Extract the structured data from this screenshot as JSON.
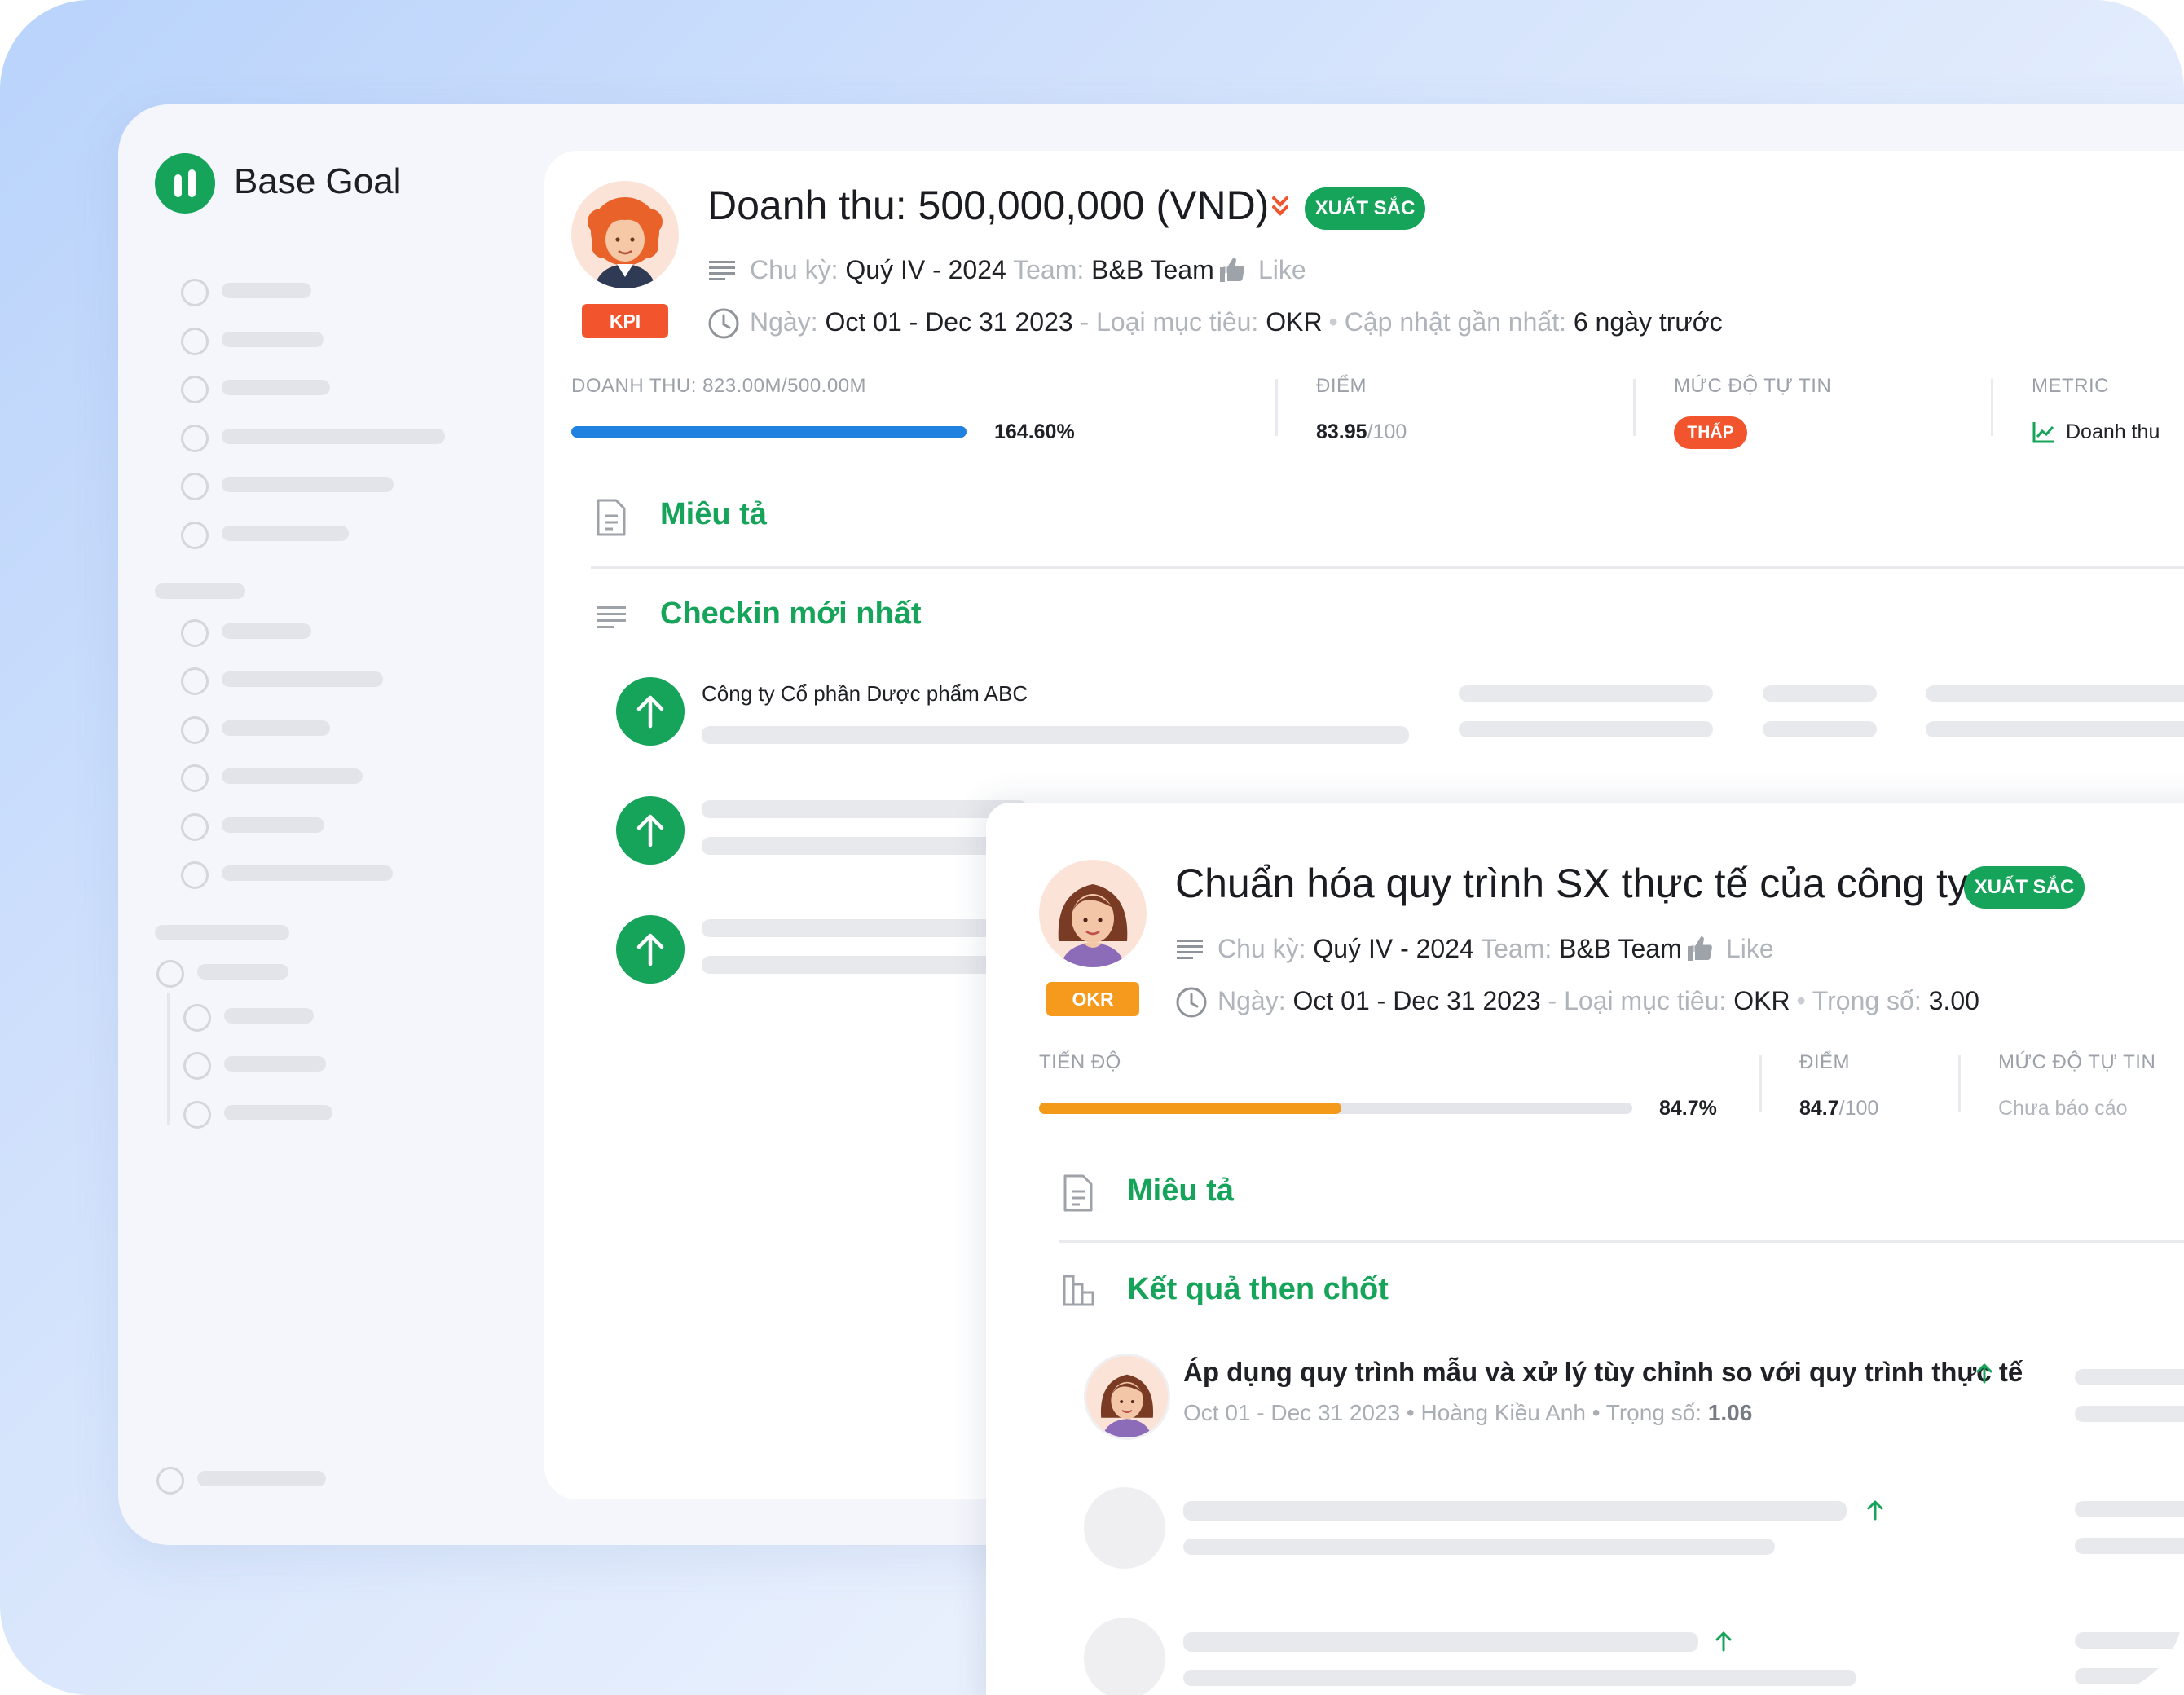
{
  "app": {
    "brand": "Base Goal"
  },
  "goal": {
    "tag": "KPI",
    "title": "Doanh thu: 500,000,000 (VND)",
    "rating": "XUẤT SẮC",
    "cycle_label": "Chu kỳ:",
    "cycle_value": "Quý IV - 2024",
    "team_label": "Team:",
    "team_value": "B&B Team",
    "like": "Like",
    "date_label": "Ngày:",
    "date_value": "Oct 01 - Dec 31 2023",
    "type_label": "- Loại mục tiêu:",
    "type_value": "OKR",
    "updated_label": "Cập nhật gần nhất:",
    "updated_value": "6 ngày trước",
    "progress_label": "DOANH THU: 823.00M/500.00M",
    "progress_value": "164.60%",
    "progress_fraction": 1.0,
    "score_label": "ĐIỂM",
    "score_value": "83.95",
    "score_max": "/100",
    "confidence_label": "MỨC ĐỘ TỰ TIN",
    "confidence_value": "THẤP",
    "metric_label": "METRIC",
    "metric_value": "Doanh thu",
    "description_title": "Miêu tả",
    "checkin_title": "Checkin mới nhất",
    "checkin_company": "Công ty Cổ phần Dược phẩm ABC"
  },
  "okr": {
    "tag": "OKR",
    "title": "Chuẩn hóa quy trình SX thực tế của công ty",
    "rating": "XUẤT SẮC",
    "cycle_label": "Chu kỳ:",
    "cycle_value": "Quý IV - 2024",
    "team_label": "Team:",
    "team_value": "B&B Team",
    "like": "Like",
    "date_label": "Ngày:",
    "date_value": "Oct 01 - Dec 31 2023",
    "type_label": "- Loại mục tiêu:",
    "type_value": "OKR",
    "weight_label": "Trọng số:",
    "weight_value": "3.00",
    "progress_label": "TIẾN ĐỘ",
    "progress_value": "84.7%",
    "progress_fraction": 0.51,
    "score_label": "ĐIỂM",
    "score_value": "84.7",
    "score_max": "/100",
    "confidence_label": "MỨC ĐỘ TỰ TIN",
    "confidence_value": "Chưa báo cáo",
    "description_title": "Miêu tả",
    "kr_section_title": "Kết quả then chốt",
    "key_result": {
      "title": "Áp dụng quy trình mẫu và xử lý tùy chỉnh so với quy trình thực tế",
      "date": "Oct 01 - Dec 31 2023",
      "owner": "Hoàng Kiều Anh",
      "weight_label": "Trọng số:",
      "weight_value": "1.06"
    }
  },
  "colors": {
    "brand_green": "#16a35a",
    "kpi_tag": "#f2542d",
    "okr_tag": "#f59a1c",
    "progress_blue": "#1f82e0",
    "progress_orange": "#f39a1b",
    "low_badge": "#f2542d"
  },
  "icons": [
    "logo-icon",
    "circle-icon",
    "lines-icon",
    "thumb-up-icon",
    "clock-icon",
    "double-chevron-down-icon",
    "chart-line-icon",
    "document-icon",
    "arrow-up-icon",
    "bar-chart-icon"
  ]
}
